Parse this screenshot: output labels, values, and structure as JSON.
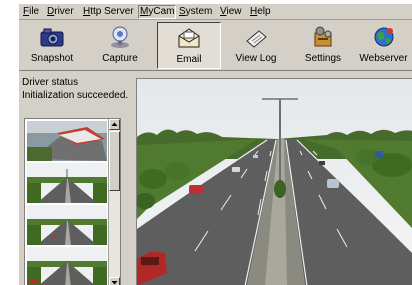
{
  "menu": [
    "File",
    "Driver",
    "Http Server",
    "MyCam",
    "System",
    "View",
    "Help"
  ],
  "toolbar": [
    {
      "label": "Snapshot",
      "icon": "camera-icon"
    },
    {
      "label": "Capture",
      "icon": "capture-icon"
    },
    {
      "label": "Email",
      "icon": "email-icon"
    },
    {
      "label": "View Log",
      "icon": "view-log-icon"
    },
    {
      "label": "Settings",
      "icon": "settings-icon"
    },
    {
      "label": "Webserver",
      "icon": "webserver-icon"
    }
  ],
  "status": {
    "title": "Driver status",
    "message": "Initialization succeeded."
  },
  "colors": {
    "window_bg": "#d4d0c8",
    "sky": "#eef0f2",
    "road": "#5e5e5e",
    "grass": "#4f7a2f"
  }
}
